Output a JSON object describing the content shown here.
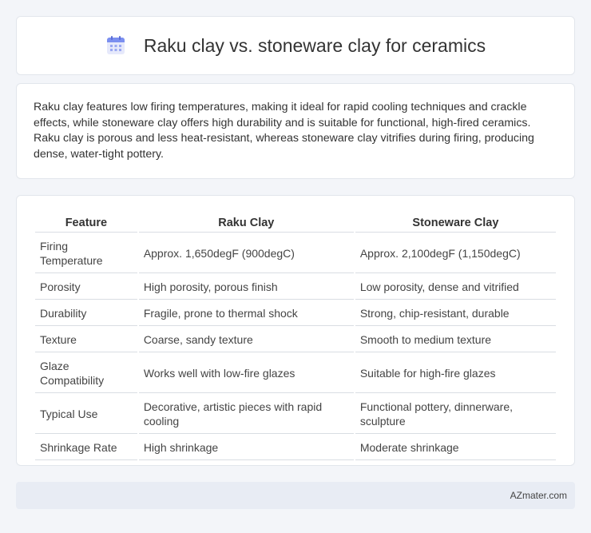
{
  "header": {
    "title": "Raku clay vs. stoneware clay for ceramics",
    "icon": "calendar-icon"
  },
  "summary": {
    "text": "Raku clay features low firing temperatures, making it ideal for rapid cooling techniques and crackle effects, while stoneware clay offers high durability and is suitable for functional, high-fired ceramics. Raku clay is porous and less heat-resistant, whereas stoneware clay vitrifies during firing, producing dense, water-tight pottery."
  },
  "table": {
    "headers": [
      "Feature",
      "Raku Clay",
      "Stoneware Clay"
    ],
    "rows": [
      [
        "Firing Temperature",
        "Approx. 1,650degF (900degC)",
        "Approx. 2,100degF (1,150degC)"
      ],
      [
        "Porosity",
        "High porosity, porous finish",
        "Low porosity, dense and vitrified"
      ],
      [
        "Durability",
        "Fragile, prone to thermal shock",
        "Strong, chip-resistant, durable"
      ],
      [
        "Texture",
        "Coarse, sandy texture",
        "Smooth to medium texture"
      ],
      [
        "Glaze Compatibility",
        "Works well with low-fire glazes",
        "Suitable for high-fire glazes"
      ],
      [
        "Typical Use",
        "Decorative, artistic pieces with rapid cooling",
        "Functional pottery, dinnerware, sculpture"
      ],
      [
        "Shrinkage Rate",
        "High shrinkage",
        "Moderate shrinkage"
      ]
    ]
  },
  "footer": {
    "site": "AZmater.com"
  },
  "colors": {
    "background": "#f3f5f9",
    "card": "#ffffff",
    "footer": "#e8ecf4",
    "icon_top": "#7b8ff0",
    "icon_body": "#e6e9fb"
  }
}
